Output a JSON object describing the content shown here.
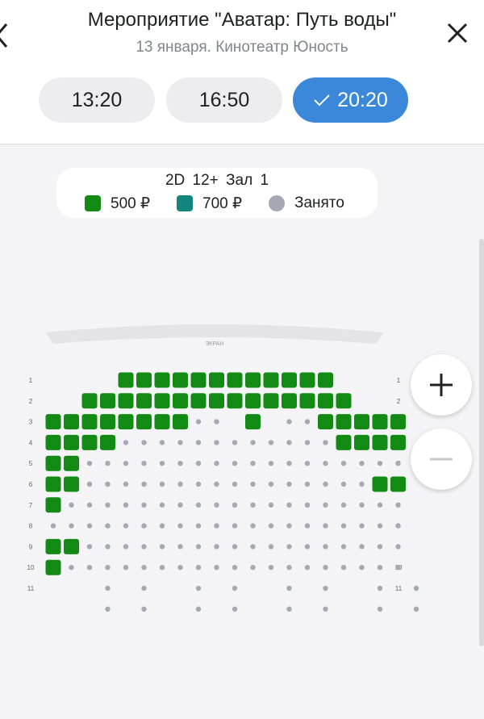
{
  "header": {
    "title": "Мероприятие \"Аватар: Путь воды\"",
    "subtitle": "13 января.  Кинотеатр Юность"
  },
  "sessions": [
    {
      "time": "13:20",
      "selected": false
    },
    {
      "time": "16:50",
      "selected": false
    },
    {
      "time": "20:20",
      "selected": true
    }
  ],
  "legend": {
    "meta": "2D  12+  Зал 1",
    "items": [
      {
        "label": "500 ₽",
        "color": "#138a13"
      },
      {
        "label": "700 ₽",
        "color": "#12857f"
      },
      {
        "label": "Занято",
        "color": "#a6a9b4"
      }
    ]
  },
  "screen_label": "ЭКРАН",
  "colors": {
    "accent": "#3b87d9",
    "seat_free": "#138a13",
    "seat_taken": "#a6a9b4"
  },
  "rows": [
    {
      "label": "1",
      "seats": "____FFFFFFFFFFFF____"
    },
    {
      "label": "2",
      "seats": "__FFFFFFFFFFFFFFF___"
    },
    {
      "label": "3",
      "seats": "FFFFFFFFtt F ttFFFFF"
    },
    {
      "label": "4",
      "seats": "FFFFttttttttttttFFFF"
    },
    {
      "label": "5",
      "seats": "FFtttttttttttttttttt"
    },
    {
      "label": "6",
      "seats": "FFttttttttttttttttFF"
    },
    {
      "label": "7",
      "seats": "Fttttttttttttttttttt"
    },
    {
      "label": "8",
      "seats": "tttttttttttttttttttt"
    },
    {
      "label": "9",
      "seats": "FFtttttttttttttttttt"
    },
    {
      "label": "10",
      "seats": "Fttttttttttttttttttt"
    },
    {
      "label": "11",
      "seats": "___t_t__t_t__t_t__t_t"
    }
  ],
  "extra_row_seats": "___t_t__t_t__t_t__t_t"
}
